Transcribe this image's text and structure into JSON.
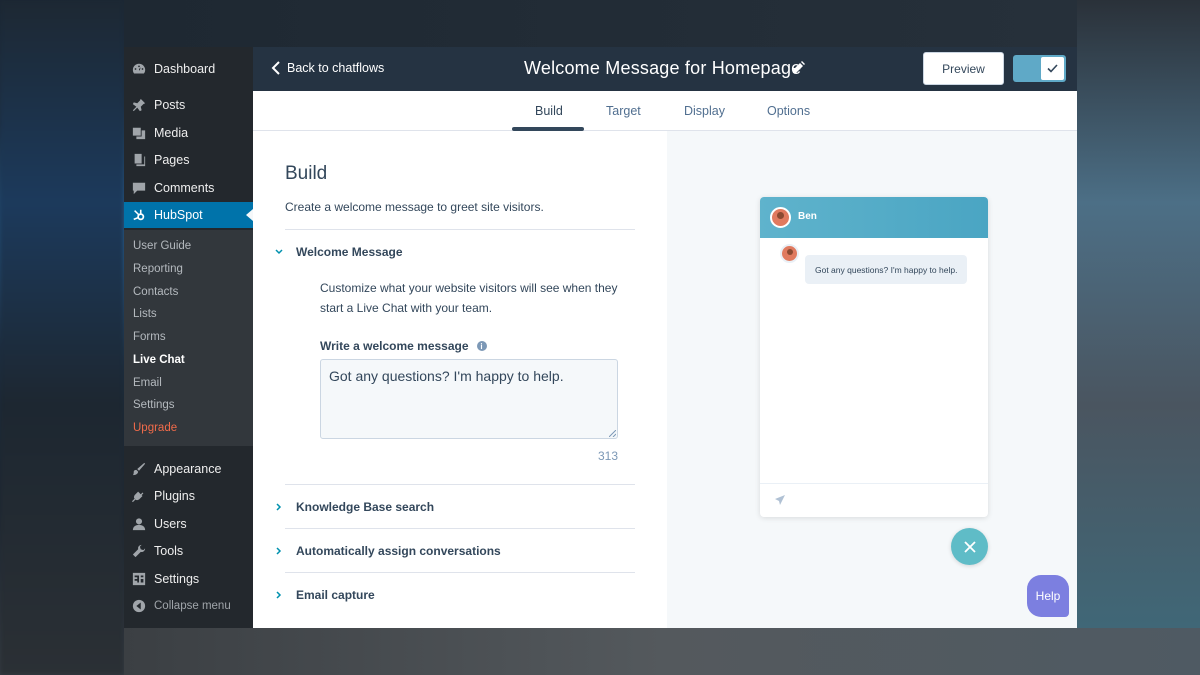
{
  "sidebar": {
    "items": [
      {
        "label": "Dashboard",
        "icon": "dashboard-icon"
      },
      {
        "label": "Posts",
        "icon": "pin-icon"
      },
      {
        "label": "Media",
        "icon": "media-icon"
      },
      {
        "label": "Pages",
        "icon": "pages-icon"
      },
      {
        "label": "Comments",
        "icon": "comments-icon"
      },
      {
        "label": "HubSpot",
        "icon": "hubspot-icon"
      }
    ],
    "submenu": [
      "User Guide",
      "Reporting",
      "Contacts",
      "Lists",
      "Forms",
      "Live Chat",
      "Email",
      "Settings",
      "Upgrade"
    ],
    "bottom_items": [
      {
        "label": "Appearance",
        "icon": "brush-icon"
      },
      {
        "label": "Plugins",
        "icon": "plug-icon"
      },
      {
        "label": "Users",
        "icon": "user-icon"
      },
      {
        "label": "Tools",
        "icon": "wrench-icon"
      },
      {
        "label": "Settings",
        "icon": "settings-icon"
      }
    ],
    "collapse_label": "Collapse menu"
  },
  "header": {
    "back_label": "Back to chatflows",
    "title": "Welcome Message for Homepage",
    "preview_label": "Preview"
  },
  "tabs": [
    "Build",
    "Target",
    "Display",
    "Options"
  ],
  "build": {
    "heading": "Build",
    "subheading": "Create a welcome message to greet site visitors.",
    "welcome_section": {
      "title": "Welcome Message",
      "description": "Customize what your website visitors will see when they start a Live Chat with your team.",
      "field_label": "Write a welcome message",
      "field_value": "Got any questions? I'm happy to help.",
      "char_count": "313"
    },
    "sections": [
      "Knowledge Base search",
      "Automatically assign conversations",
      "Email capture"
    ]
  },
  "chat_preview": {
    "agent_name": "Ben",
    "message": "Got any questions? I'm happy to help.",
    "help_label": "Help"
  },
  "colors": {
    "wp_sidebar": "#23282d",
    "wp_active": "#0073aa",
    "header": "#253342",
    "chat_header": "#4aa5c3",
    "upgrade": "#f06b4a",
    "help": "#7c7fe0"
  }
}
